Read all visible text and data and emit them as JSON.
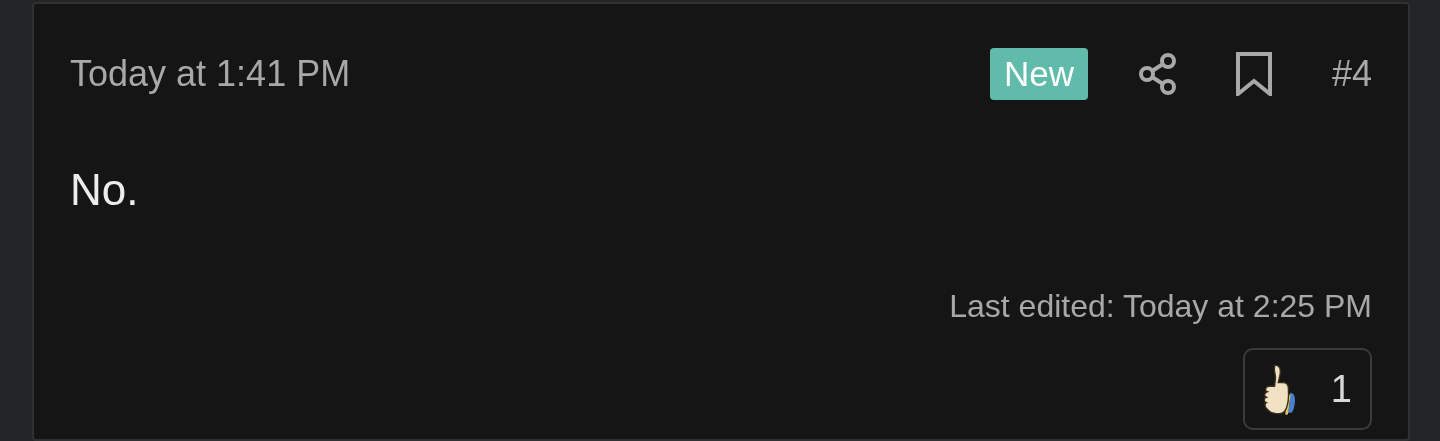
{
  "post": {
    "date": "Today at 1:41 PM",
    "new_badge": "New",
    "number": "#4",
    "body": "No.",
    "last_edited": "Last edited: Today at 2:25 PM",
    "reactions": [
      {
        "count": "1"
      }
    ]
  }
}
